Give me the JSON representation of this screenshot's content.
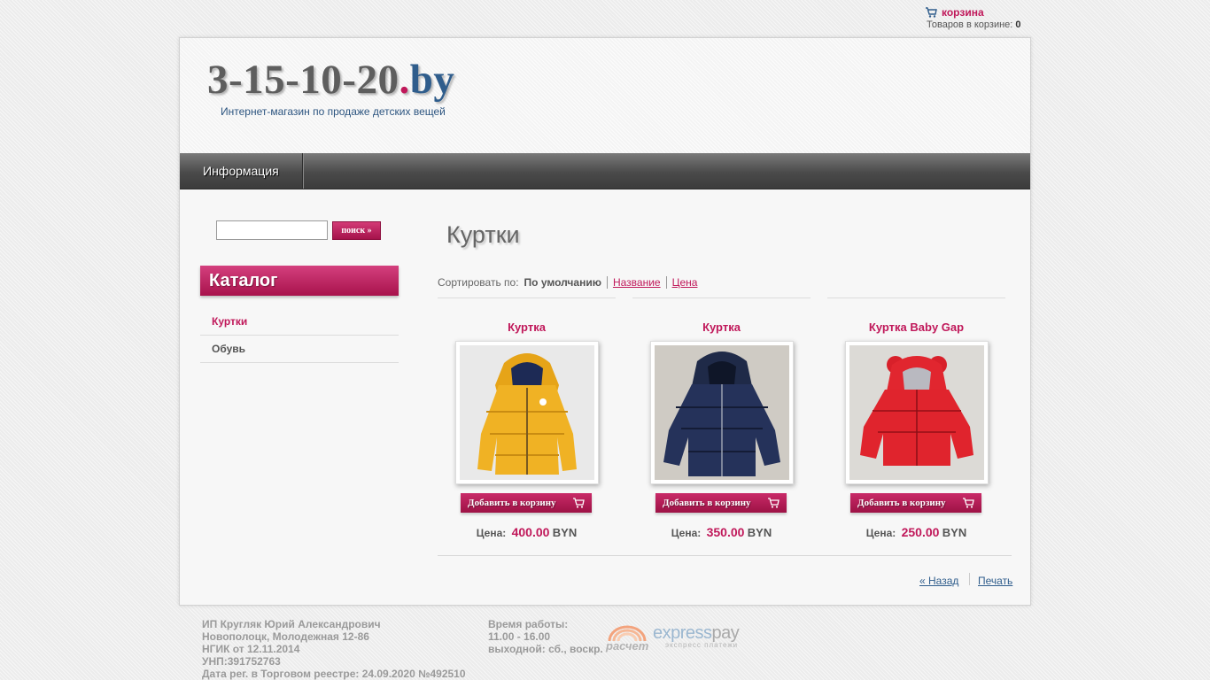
{
  "cart": {
    "link_label": "корзина",
    "count_label": "Товаров в корзине:",
    "count": "0"
  },
  "header": {
    "logo_main": "3-15-10-20",
    "logo_dot": ".",
    "logo_tld": "by",
    "tagline": "Интернет-магазин по продаже детских вещей"
  },
  "nav": {
    "items": [
      {
        "label": "Информация"
      }
    ]
  },
  "search": {
    "value": "",
    "button_label": "поиск »"
  },
  "catalog": {
    "title": "Каталог",
    "items": [
      {
        "label": "Куртки",
        "active": true
      },
      {
        "label": "Обувь",
        "active": false
      }
    ]
  },
  "content": {
    "title": "Куртки",
    "sort": {
      "label": "Сортировать по:",
      "current": "По умолчанию",
      "options": [
        "Название",
        "Цена"
      ]
    },
    "add_to_cart_label": "Добавить в корзину",
    "price_label": "Цена:",
    "products": [
      {
        "name": "Куртка",
        "price": "400.00",
        "currency": "BYN",
        "image_icon": "yellow-jacket-photo"
      },
      {
        "name": "Куртка",
        "price": "350.00",
        "currency": "BYN",
        "image_icon": "navy-jacket-photo"
      },
      {
        "name": "Куртка Baby Gap",
        "price": "250.00",
        "currency": "BYN",
        "image_icon": "red-jacket-photo"
      }
    ],
    "back_label": "« Назад",
    "print_label": "Печать"
  },
  "footer": {
    "company": [
      "ИП Кругляк Юрий Александрович",
      "Новополоцк, Молодежная 12-86",
      "НГИК от 12.11.2014",
      "УНП:391752763",
      "Дата рег. в Торговом реестре: 24.09.2020 №492510"
    ],
    "hours_title": "Время работы:",
    "hours": "11.00 - 16.00",
    "days_off": "выходной: сб., воскр.",
    "raschet_label": "расчет",
    "expresspay_prefix": "express",
    "expresspay_suffix": "pay",
    "expresspay_sub": "экспресс платежи"
  },
  "colors": {
    "accent": "#c0185a",
    "link": "#2f5d8c",
    "nav": "#4a4a4a"
  }
}
